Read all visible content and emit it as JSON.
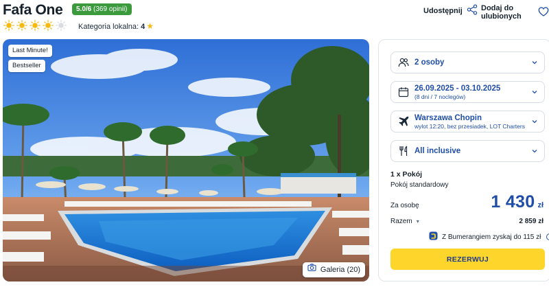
{
  "hotel": {
    "name": "Fafa One",
    "rating_score": "5.0/6",
    "rating_count": "(369 opinii)",
    "suns_filled": 4,
    "suns_total": 5,
    "local_category_label": "Kategoria lokalna:",
    "local_category_value": "4"
  },
  "actions": {
    "share_label": "Udostępnij",
    "favorite_label": "Dodaj do ulubionych"
  },
  "photo": {
    "tags": [
      "Last Minute!",
      "Bestseller"
    ],
    "gallery_label": "Galeria (20)"
  },
  "booking": {
    "travellers": "2 osoby",
    "dates_main": "26.09.2025 - 03.10.2025",
    "dates_sub": "(8 dni / 7 noclegów)",
    "departure_main": "Warszawa Chopin",
    "departure_sub": "wylot 12:20, bez przesiadek, LOT Charters",
    "board": "All inclusive",
    "room_count": "1 x Pokój",
    "room_type": "Pokój standardowy",
    "per_person_label": "Za osobę",
    "price_per_person": "1 430",
    "currency": "zł",
    "total_label": "Razem",
    "total_value": "2 859 zł",
    "bumerang_text": "Z Bumerangiem zyskaj do 115 zł",
    "reserve_label": "REZERWUJ"
  },
  "colors": {
    "accent_blue": "#1f4ea8",
    "rating_green": "#3a9a3c",
    "cta_yellow": "#fed52b",
    "sun_yellow": "#f5b90f"
  }
}
